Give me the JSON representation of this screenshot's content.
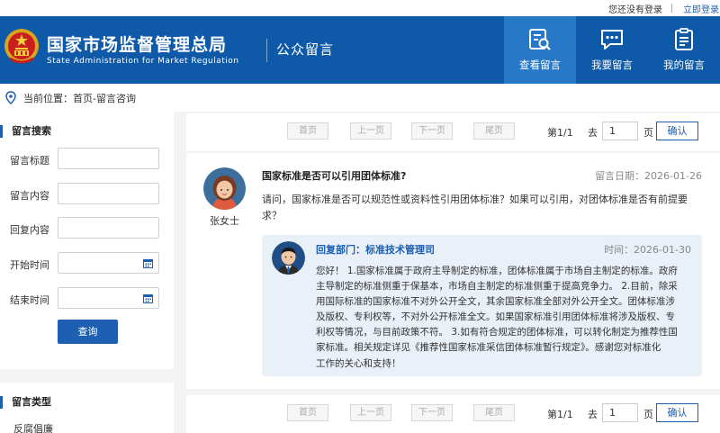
{
  "topbar": {
    "status": "您还没有登录",
    "login": "立即登录"
  },
  "header": {
    "title": "国家市场监督管理总局",
    "subtitle": "State Administration for Market Regulation",
    "section": "公众留言",
    "nav": [
      {
        "label": "查看留言",
        "icon": "search-document-icon",
        "active": true
      },
      {
        "label": "我要留言",
        "icon": "chat-bubble-icon",
        "active": false
      },
      {
        "label": "我的留言",
        "icon": "clipboard-list-icon",
        "active": false
      }
    ],
    "colors": {
      "primary": "#0f5aa8",
      "active": "#2878c8"
    }
  },
  "breadcrumb": {
    "text": "当前位置：首页-留言咨询"
  },
  "search": {
    "heading": "留言搜索",
    "fields": [
      {
        "label": "留言标题",
        "value": ""
      },
      {
        "label": "留言内容",
        "value": ""
      },
      {
        "label": "回复内容",
        "value": ""
      },
      {
        "label": "开始时间",
        "value": ""
      },
      {
        "label": "结束时间",
        "value": ""
      }
    ],
    "button": "查询"
  },
  "types": {
    "heading": "留言类型",
    "items": [
      "反腐倡廉"
    ]
  },
  "pagination": {
    "first": "首页",
    "prev": "上一页",
    "next": "下一页",
    "last": "尾页",
    "page_info": "第1/1",
    "goto": "去",
    "page_value": "1",
    "page_unit": "页",
    "confirm": "确认"
  },
  "message": {
    "title": "国家标准是否可以引用团体标准?",
    "date": "留言日期：2026-01-26",
    "asker": "张女士",
    "body": "请问，国家标准是否可以规范性或资料性引用团体标准？如果可以引用，对团体标准是否有前提要求？",
    "reply": {
      "dept": "回复部门：标准技术管理司",
      "time": "时间：2026-01-30",
      "lines": [
        "您好！ 1.国家标准属于政府主导制定的标准，团体标准属于市场自主制定的标准。政府",
        "主导制定的标准侧重于保基本，市场自主制定的标准侧重于提高竞争力。 2.目前，除采",
        "用国际标准的国家标准不对外公开全文，其余国家标准全部对外公开全文。团体标准涉",
        "及版权、专利权等，不对外公开标准全文。如果国家标准引用团体标准将涉及版权、专",
        "利权等情况，与目前政策不符。 3.如有符合规定的团体标准，可以转化制定为推荐性国",
        "家标准。相关规定详见《推荐性国家标准采信团体标准暂行规定》。感谢您对标准化",
        "工作的关心和支持！"
      ]
    }
  }
}
